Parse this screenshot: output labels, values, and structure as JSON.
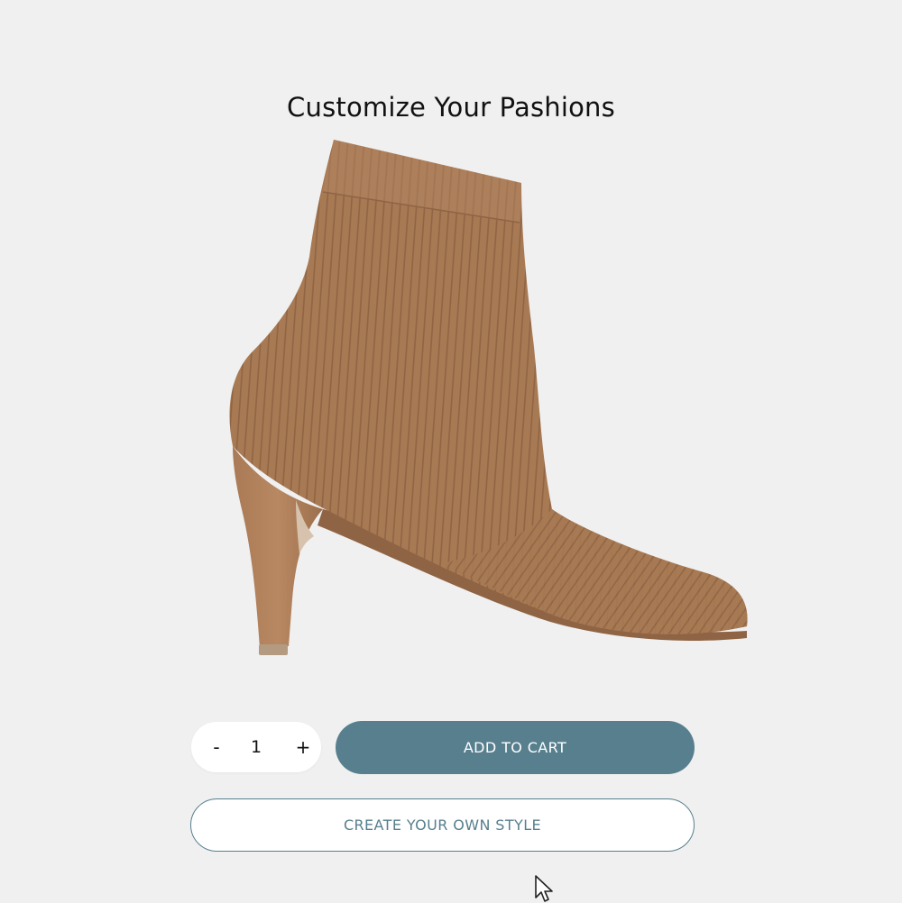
{
  "page": {
    "title": "Customize Your Pashions"
  },
  "product": {
    "image_icon": "ankle-boot-image",
    "color": "#a87a54"
  },
  "quantity": {
    "minus_label": "-",
    "value": "1",
    "plus_label": "+"
  },
  "actions": {
    "add_to_cart_label": "ADD TO CART",
    "create_style_label": "CREATE YOUR OWN STYLE"
  },
  "colors": {
    "accent": "#577f8e",
    "background": "#f0f0f0"
  }
}
